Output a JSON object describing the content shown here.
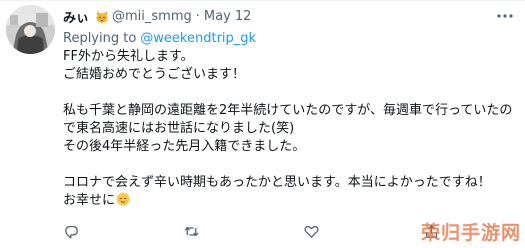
{
  "tweet": {
    "display_name": "みぃ",
    "handle": "@mii_smmg",
    "separator": "·",
    "date": "May 12",
    "replying_label": "Replying to",
    "replying_to": "@weekendtrip_gk",
    "lines": [
      "FF外から失礼します。",
      "ご結婚おめでとうございます！",
      "",
      "私も千葉と静岡の遠距離を2年半続けていたのですが、毎週車で行っていたの",
      "で東名高速にはお世話になりました(笑)",
      "その後4年半経った先月入籍できました。",
      "",
      "コロナで会えず辛い時期もあったかと思います。本当によかったですね！",
      "お幸せに"
    ],
    "icons": {
      "name_emoji": "cat-face-icon",
      "end_emoji": "relieved-face-icon",
      "more": "more-dots-icon",
      "reply": "reply-icon",
      "retweet": "retweet-icon",
      "like": "like-icon",
      "share": "share-icon"
    }
  },
  "watermark": {
    "text": "荣归手游网"
  },
  "colors": {
    "accent": "#1d9bf0",
    "secondary_text": "#536471",
    "primary_text": "#0f1419"
  }
}
